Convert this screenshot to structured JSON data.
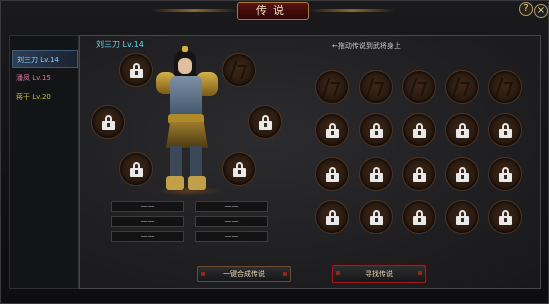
{
  "window": {
    "title": "传说",
    "help_label": "?",
    "close_label": "×"
  },
  "characters": [
    {
      "label": "刘三刀  Lv.14",
      "style": "sel"
    },
    {
      "label": "潘凤  Lv.15",
      "style": "pink"
    },
    {
      "label": "蒋干  Lv.20",
      "style": "yellow"
    }
  ],
  "hero": {
    "name": "刘三刀  Lv.14"
  },
  "hint": "←拖动传说到武将身上",
  "equip_slots": [
    {
      "name": "equip-slot-top-left",
      "locked": true
    },
    {
      "name": "equip-slot-top-right",
      "locked": false
    },
    {
      "name": "equip-slot-middle-left",
      "locked": true
    },
    {
      "name": "equip-slot-middle-right",
      "locked": true
    },
    {
      "name": "equip-slot-bottom-left",
      "locked": true
    },
    {
      "name": "equip-slot-bottom-right",
      "locked": true
    }
  ],
  "inventory": {
    "rows": [
      [
        false,
        false,
        false,
        false,
        false
      ],
      [
        true,
        true,
        true,
        true,
        true
      ],
      [
        true,
        true,
        true,
        true,
        true
      ],
      [
        true,
        true,
        true,
        true,
        true
      ]
    ]
  },
  "stats": [
    "——",
    "——",
    "——",
    "——",
    "——",
    "——"
  ],
  "buttons": {
    "combine": "一键合成传说",
    "find": "寻找传说"
  },
  "colors": {
    "accent_name": "#67d7f2",
    "highlight_border": "#a21a1a"
  }
}
